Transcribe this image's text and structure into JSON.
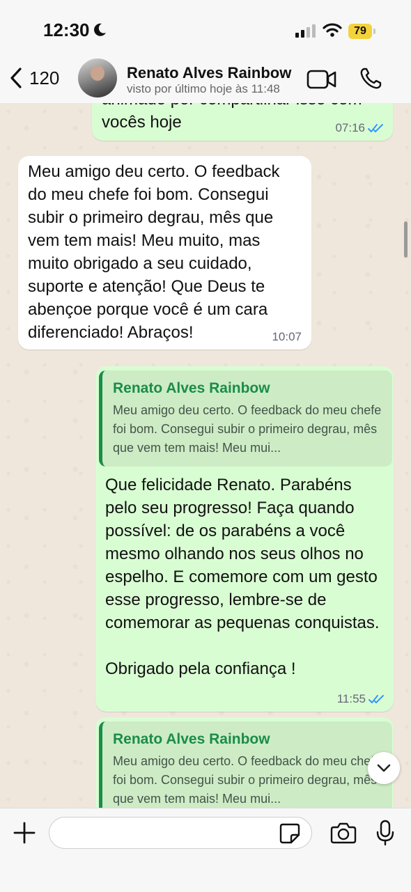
{
  "status_bar": {
    "time": "12:30",
    "battery": "79"
  },
  "header": {
    "back_count": "120",
    "contact_name": "Renato Alves Rainbow",
    "contact_status": "visto por último hoje às 11:48"
  },
  "messages": [
    {
      "type": "outgoing",
      "text": "animado por compartilhar isso com\nvocês hoje",
      "time": "07:16",
      "read": true
    },
    {
      "type": "incoming",
      "text": "Meu amigo deu certo. O feedback do meu chefe foi bom. Consegui subir o primeiro degrau, mês que vem tem mais! Meu muito, mas muito obrigado a seu cuidado, suporte e atenção! Que Deus te abençoe porque você é um cara diferenciado! Abraços!",
      "time": "10:07"
    },
    {
      "type": "outgoing",
      "quote": {
        "author": "Renato Alves Rainbow",
        "text": "Meu amigo deu certo. O feedback do meu chefe foi bom. Consegui subir o primeiro degrau, mês que vem tem mais! Meu mui..."
      },
      "text": "Que felicidade Renato. Parabéns pelo seu progresso! Faça quando possível: de os parabéns a você mesmo olhando nos seus olhos no espelho. E comemore com um gesto esse progresso, lembre-se de comemorar as pequenas conquistas.\n\nObrigado pela confiança !",
      "time": "11:55",
      "read": true
    },
    {
      "type": "outgoing",
      "quote": {
        "author": "Renato Alves Rainbow",
        "text": "Meu amigo deu certo. O feedback do meu chefe foi bom. Consegui subir o primeiro degrau, mês que vem tem mais! Meu mui..."
      }
    }
  ],
  "input": {
    "placeholder": ""
  },
  "colors": {
    "outgoing_bubble": "#d9fdd3",
    "incoming_bubble": "#ffffff",
    "quote_accent": "#1b8c4a",
    "read_ticks": "#3497f9"
  },
  "icons": [
    "moon-icon",
    "signal-icon",
    "wifi-icon",
    "battery-icon",
    "back-chevron-icon",
    "video-call-icon",
    "phone-icon",
    "double-check-icon",
    "chevron-down-icon",
    "plus-icon",
    "sticker-icon",
    "camera-icon",
    "microphone-icon"
  ]
}
